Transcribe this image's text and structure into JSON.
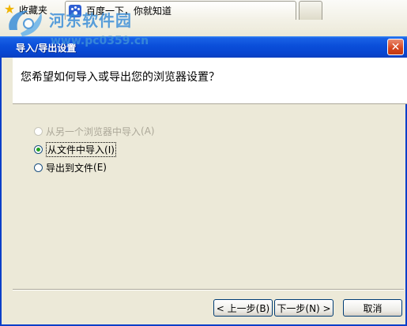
{
  "browser": {
    "favorites_label": "收藏夹",
    "tab_title": "百度一下，你就知道",
    "icons": {
      "favorites": "star-icon",
      "tab": "baidu-paw-icon"
    }
  },
  "watermark": {
    "title": "河东软件园",
    "url": "www.pc0359.cn"
  },
  "dialog": {
    "title": "导入/导出设置",
    "question": "您希望如何导入或导出您的浏览器设置？",
    "options": [
      {
        "label": "从另一个浏览器中导入",
        "accel": "(A)",
        "checked": false,
        "disabled": true
      },
      {
        "label": "从文件中导入",
        "accel": "(I)",
        "checked": true,
        "disabled": false
      },
      {
        "label": "导出到文件",
        "accel": "(E)",
        "checked": false,
        "disabled": false
      }
    ],
    "buttons": {
      "back": "< 上一步(B)",
      "next": "下一步(N) >",
      "cancel": "取消"
    },
    "colors": {
      "titlebar": "#0a4ed9",
      "close": "#d5441d",
      "face": "#ece9d8"
    }
  }
}
